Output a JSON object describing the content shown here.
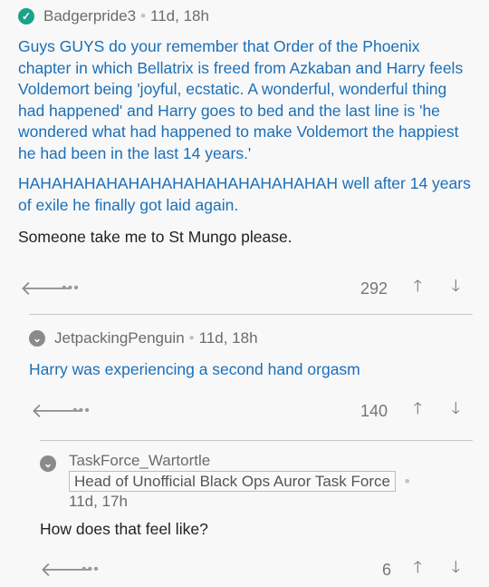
{
  "comments": [
    {
      "author": "Badgerpride3",
      "age": "11d, 18h",
      "paragraphs": [
        "Guys GUYS do your remember that Order of the Phoenix chapter in which Bellatrix is freed from Azkaban and Harry feels Voldemort being 'joyful, ecstatic. A wonderful, wonderful thing had happened' and Harry goes to bed and the last line is 'he wondered what had happened to make Voldemort the happiest he had been in the last 14 years.'",
        "HAHAHAHAHAHAHAHAHAHAHAHAHAHAH well after 14 years of exile he finally got laid again.",
        "Someone take me to St Mungo please."
      ],
      "score": "292",
      "more_label": "•••"
    },
    {
      "author": "JetpackingPenguin",
      "age": "11d, 18h",
      "text": "Harry was experiencing a second hand orgasm",
      "score": "140",
      "more_label": "•••"
    },
    {
      "author": "TaskForce_Wartortle",
      "flair": "Head of Unofficial Black Ops Auror Task Force",
      "age": "11d, 17h",
      "text": "How does that feel like?",
      "score": "6",
      "more_label": "•••"
    }
  ],
  "icons": {
    "check": "✓",
    "reply": "🡐",
    "upvote": "🡑",
    "downvote": "🡓",
    "separator": "•"
  },
  "colors": {
    "highlight_text": "#1b6fb8",
    "check_green": "#1aa38a",
    "background": "#f8f8f8"
  }
}
